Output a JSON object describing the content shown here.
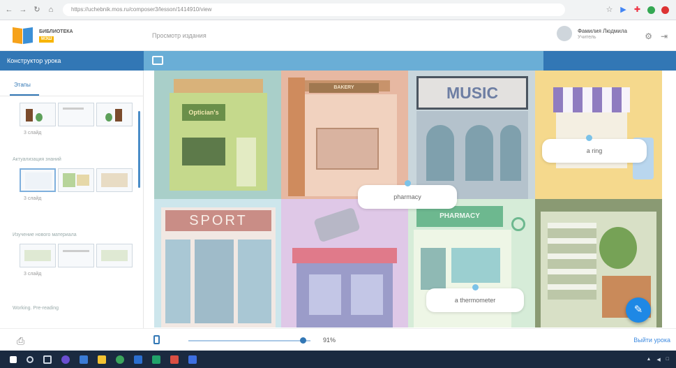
{
  "browser": {
    "url": "https://uchebnik.mos.ru/composer3/lesson/1414910/view",
    "icons": [
      "back-icon",
      "forward-icon",
      "reload-icon",
      "home-icon",
      "lock-icon"
    ],
    "ext_icons": [
      "bookmark-icon",
      "cast-icon",
      "extension-icon",
      "profile-icon",
      "menu-icon"
    ]
  },
  "header": {
    "logo_line1": "БИБЛИОТЕКА",
    "logo_badge": "МЭШ",
    "title": "Просмотр издания",
    "user_name": "Фамилия Людмила",
    "user_role": "Учитель"
  },
  "bluebar": {
    "title": "Конструктор урока"
  },
  "sidebar": {
    "tab": "Этапы",
    "stages": [
      {
        "title": "",
        "meta": "3 слайд"
      },
      {
        "title": "Актуализация знаний",
        "meta": "3 слайд"
      },
      {
        "title": "Изучение нового материала",
        "meta": "3 слайд"
      },
      {
        "title": "Working. Pre-reading",
        "meta": ""
      }
    ]
  },
  "canvas": {
    "words": [
      "pharmacy",
      "a ring",
      "a thermometer"
    ],
    "shop_signs": [
      "Optician's",
      "BAKERY",
      "MUSIC",
      "SPORT",
      "PHARMACY"
    ]
  },
  "bottom": {
    "zoom": "91%",
    "exit_label": "Выйти урока"
  },
  "colors": {
    "accent": "#3277b5",
    "bar": "#6aaed6",
    "fab": "#1e88e5"
  }
}
